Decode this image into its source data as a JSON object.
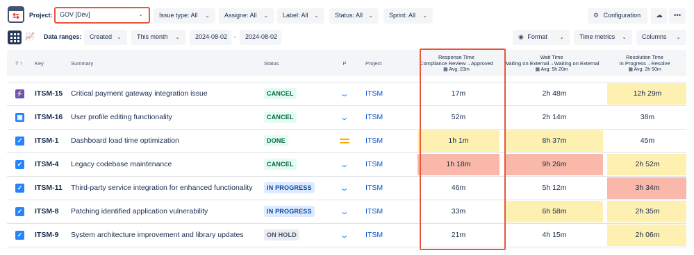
{
  "header": {
    "project_label": "Project:",
    "project_value": "GOV [Dev]",
    "filters": [
      {
        "label": "Issue type: All"
      },
      {
        "label": "Assigne: All"
      },
      {
        "label": "Label: All"
      },
      {
        "label": "Status: All"
      },
      {
        "label": "Sprint: All"
      }
    ],
    "configuration_label": "Configuration"
  },
  "toolbar": {
    "ranges_label": "Data ranges:",
    "date_field": "Created",
    "period": "This month",
    "date_from": "2024-08-02",
    "date_sep": "-",
    "date_to": "2024-08-02",
    "format_label": "Format",
    "time_metrics_label": "Time metrics",
    "columns_label": "Columns"
  },
  "table": {
    "headers": {
      "type": "T",
      "key": "Key",
      "summary": "Summary",
      "status": "Status",
      "priority": "P",
      "project": "Project"
    },
    "metrics": [
      {
        "title": "Response Time",
        "sub": "Compliance Review→Approved",
        "avg": "Avg: 23m"
      },
      {
        "title": "Wait Time",
        "sub": "Waiting on External→Waiting on External",
        "avg": "Avg: 5h 20m"
      },
      {
        "title": "Resolution Time",
        "sub": "In Progress→Resolve",
        "avg": "Avg: 2h 50m"
      }
    ],
    "rows": [
      {
        "type": "incident",
        "key": "ITSM-15",
        "summary": "Critical payment gateway integration issue",
        "status": "CANCEL",
        "status_color": "green",
        "priority": "low",
        "project": "ITSM",
        "response": "17m",
        "wait": "2h 48m",
        "resolution": "12h 29m",
        "response_hl": "",
        "wait_hl": "",
        "resolution_hl": "yellow"
      },
      {
        "type": "service",
        "key": "ITSM-16",
        "summary": "User profile editing functionality",
        "status": "CANCEL",
        "status_color": "green",
        "priority": "low",
        "project": "ITSM",
        "response": "52m",
        "wait": "2h 14m",
        "resolution": "38m",
        "response_hl": "",
        "wait_hl": "",
        "resolution_hl": ""
      },
      {
        "type": "task",
        "key": "ITSM-1",
        "summary": "Dashboard load time optimization",
        "status": "DONE",
        "status_color": "green",
        "priority": "medium",
        "project": "ITSM",
        "response": "1h 1m",
        "wait": "8h 37m",
        "resolution": "45m",
        "response_hl": "yellow",
        "wait_hl": "yellow",
        "resolution_hl": ""
      },
      {
        "type": "task",
        "key": "ITSM-4",
        "summary": "Legacy codebase maintenance",
        "status": "CANCEL",
        "status_color": "green",
        "priority": "low",
        "project": "ITSM",
        "response": "1h 18m",
        "wait": "9h 26m",
        "resolution": "2h 52m",
        "response_hl": "red",
        "wait_hl": "red",
        "resolution_hl": "yellow"
      },
      {
        "type": "task",
        "key": "ITSM-11",
        "summary": "Third-party service integration for enhanced functionality",
        "status": "IN PROGRESS",
        "status_color": "blue",
        "priority": "low",
        "project": "ITSM",
        "response": "46m",
        "wait": "5h 12m",
        "resolution": "3h 34m",
        "response_hl": "",
        "wait_hl": "",
        "resolution_hl": "red"
      },
      {
        "type": "task",
        "key": "ITSM-8",
        "summary": "Patching identified application vulnerability",
        "status": "IN PROGRESS",
        "status_color": "blue",
        "priority": "low",
        "project": "ITSM",
        "response": "33m",
        "wait": "6h 58m",
        "resolution": "2h 35m",
        "response_hl": "",
        "wait_hl": "yellow",
        "resolution_hl": "yellow"
      },
      {
        "type": "task",
        "key": "ITSM-9",
        "summary": "System architecture improvement and library updates",
        "status": "ON HOLD",
        "status_color": "gray",
        "priority": "low",
        "project": "ITSM",
        "response": "21m",
        "wait": "4h 15m",
        "resolution": "2h 06m",
        "response_hl": "",
        "wait_hl": "",
        "resolution_hl": "yellow"
      }
    ]
  }
}
